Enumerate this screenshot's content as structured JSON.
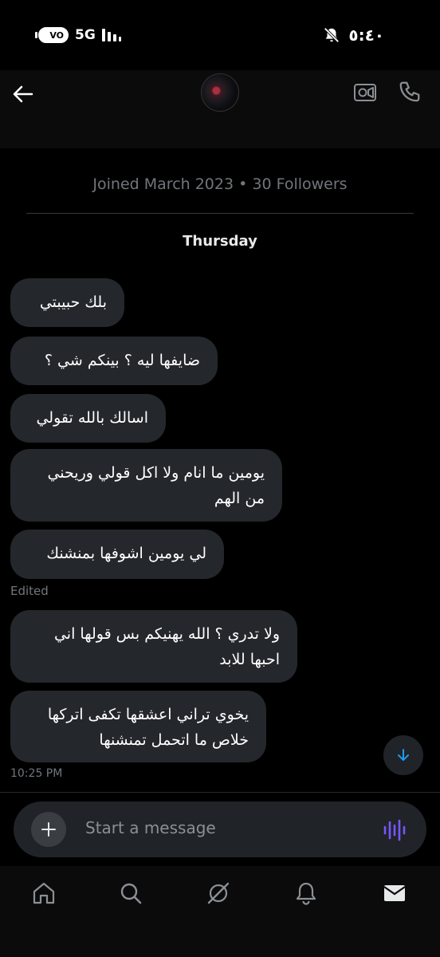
{
  "status_bar": {
    "volte": "VO",
    "network": "5G",
    "time": "٥:٤٠"
  },
  "header": {
    "back_icon": "arrow-left-icon",
    "video_icon": "video-call-icon",
    "phone_icon": "phone-call-icon"
  },
  "profile_info": "Joined March 2023 • 30 Followers",
  "day_label": "Thursday",
  "messages": [
    "بلك حبيبتي",
    "ضايفها ليه ؟ بينكم شي ؟",
    "اسالك بالله تقولي",
    "يومين ما انام ولا اكل قولي وريحني من الهم",
    "لي يومين اشوفها بمنشنك",
    "ولا تدري ؟ الله يهنيكم بس قولها اني احبها للابد",
    "يخوي تراني اعشقها تكفى اتركها خلاص ما اتحمل تمنشنها"
  ],
  "edited_label": "Edited",
  "last_timestamp": "10:25 PM",
  "composer": {
    "placeholder": "Start a message"
  },
  "colors": {
    "accent_blue": "#1d9bf0",
    "voice_purple": "#7856ff",
    "bubble_bg": "#24272b"
  },
  "nav": [
    "home-icon",
    "search-icon",
    "grok-icon",
    "notifications-icon",
    "messages-icon"
  ]
}
